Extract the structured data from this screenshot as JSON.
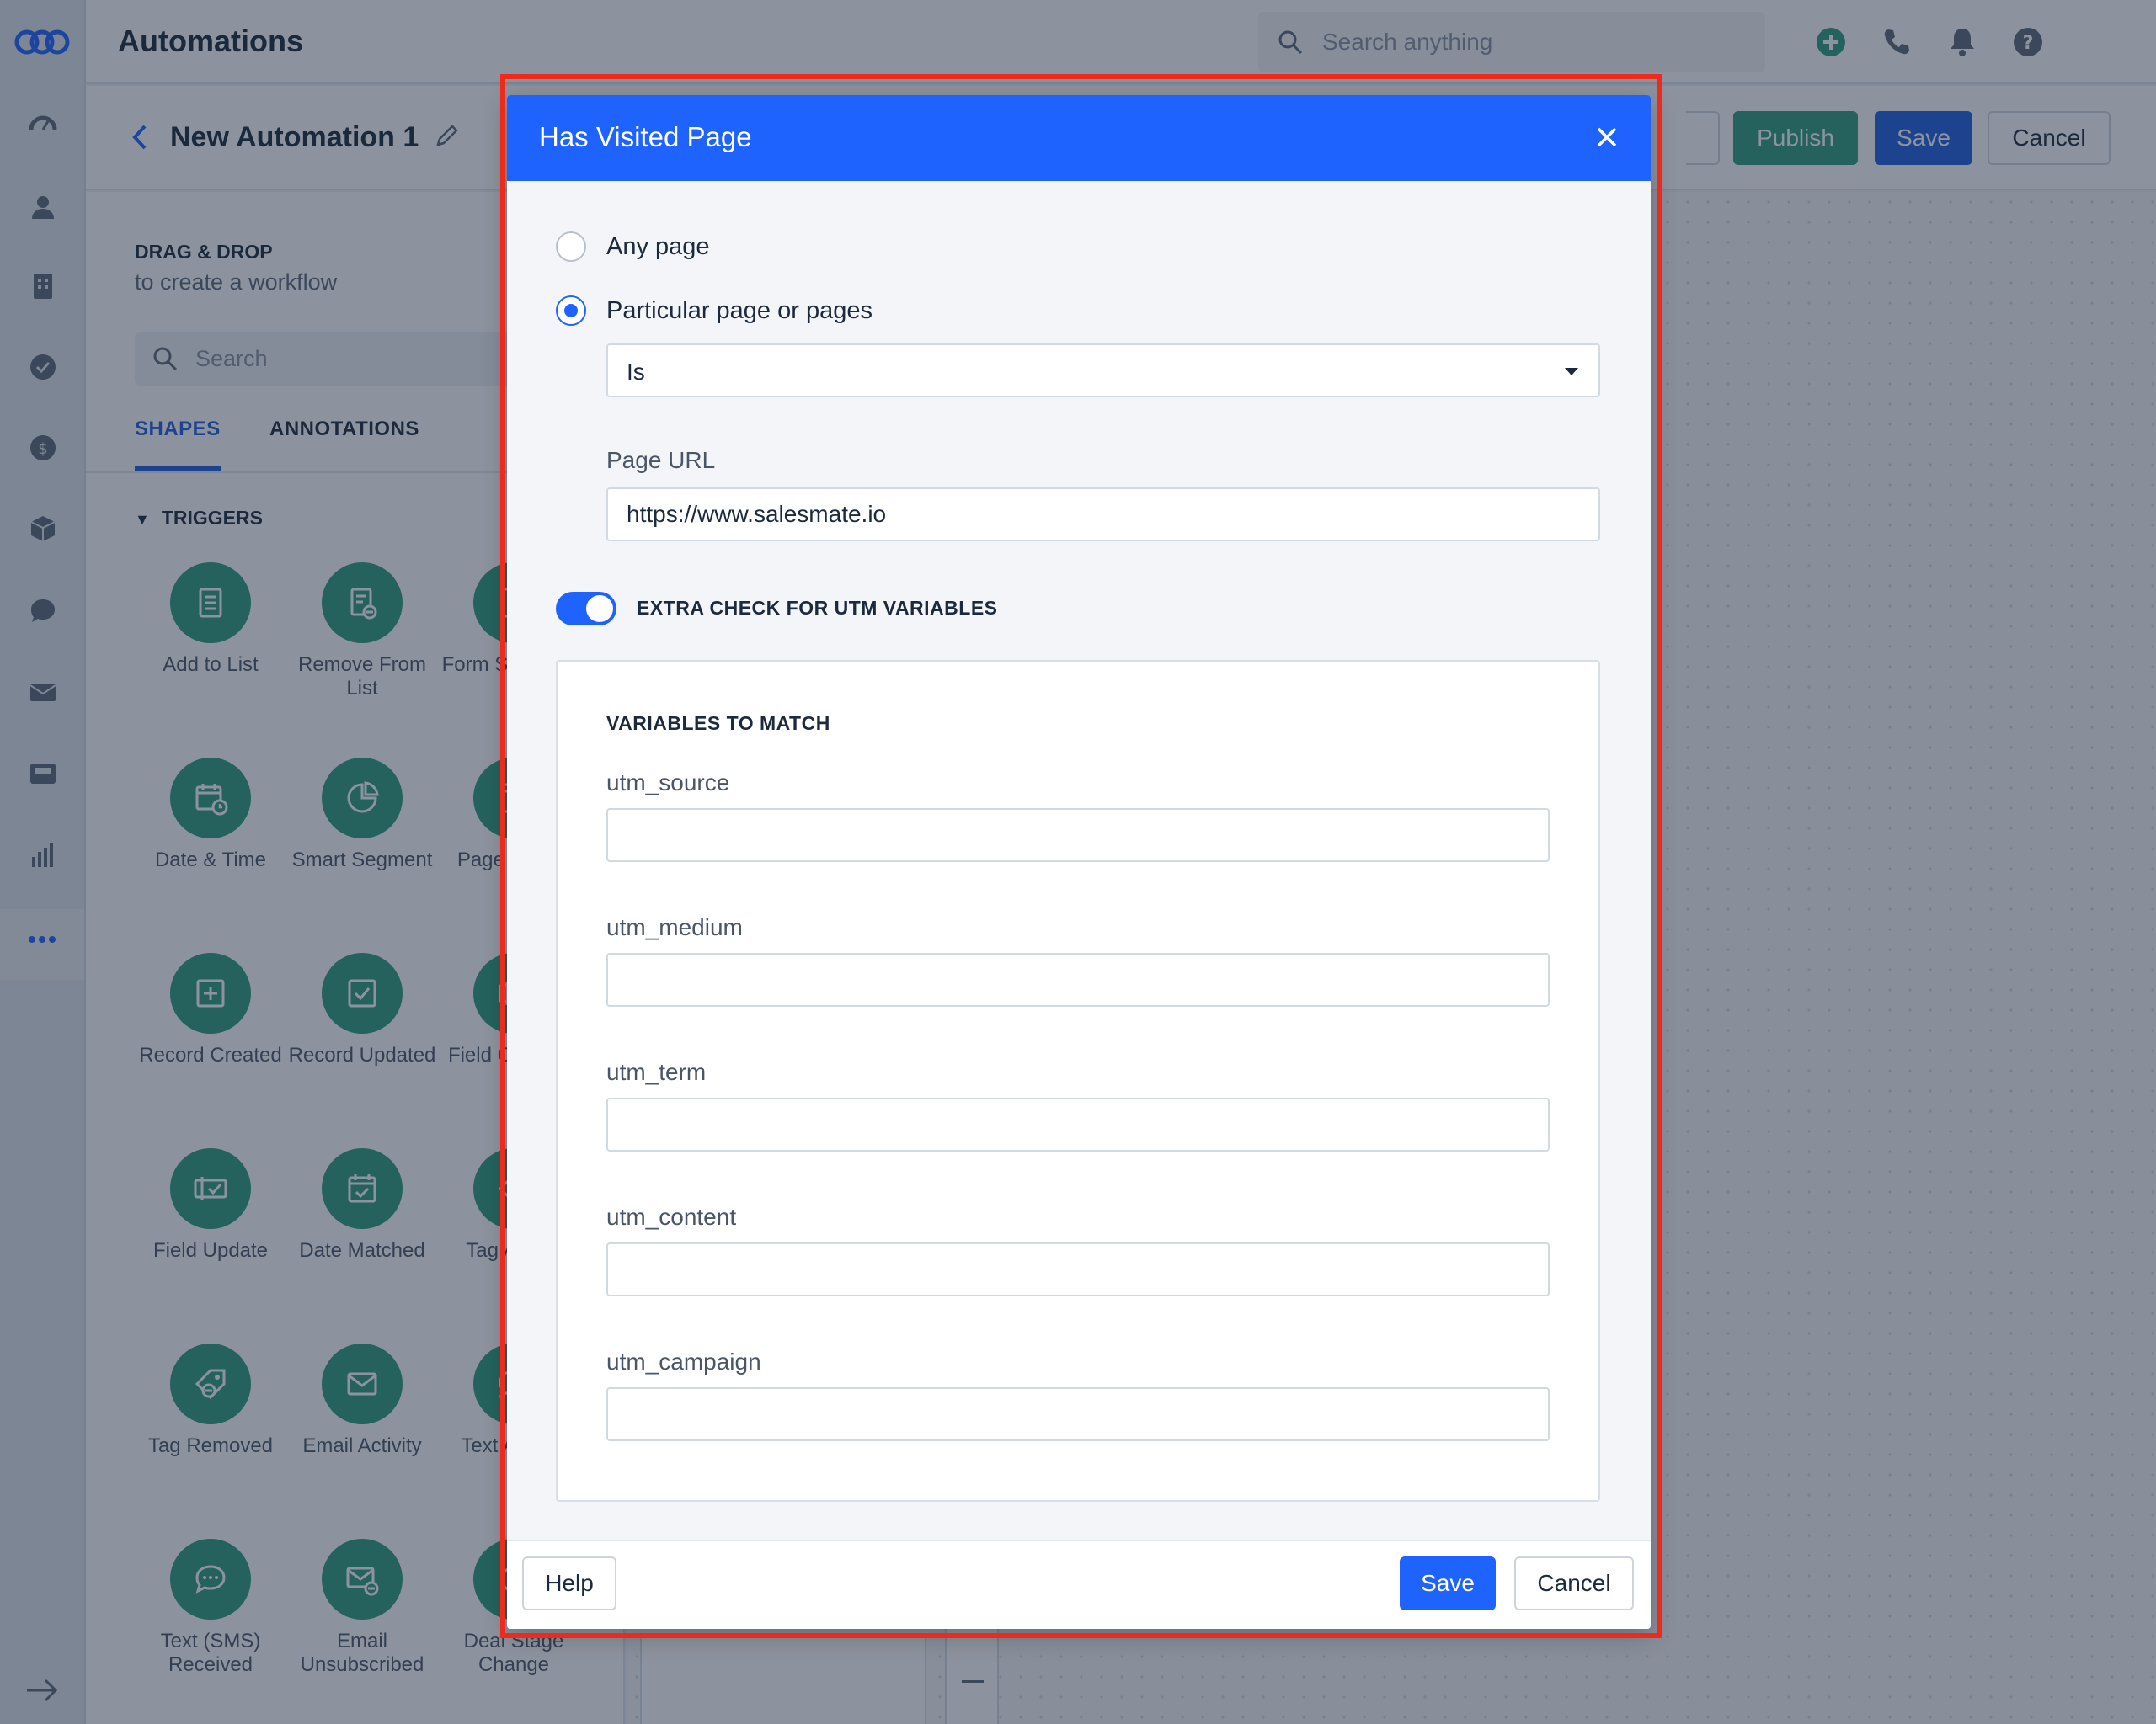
{
  "app": {
    "title": "Automations"
  },
  "header": {
    "search_placeholder": "Search anything"
  },
  "subheader": {
    "automation_name": "New Automation 1",
    "publish_label": "Publish",
    "save_label": "Save",
    "cancel_label": "Cancel"
  },
  "panel": {
    "title": "DRAG & DROP",
    "subtitle": "to create a workflow",
    "search_placeholder": "Search",
    "tabs": [
      "SHAPES",
      "ANNOTATIONS"
    ],
    "section": "TRIGGERS",
    "shapes": [
      {
        "label": "Add to List",
        "icon": "list-icon"
      },
      {
        "label": "Remove From List",
        "icon": "list-remove-icon"
      },
      {
        "label": "Form Submitted",
        "icon": "form-icon"
      },
      {
        "label": "Date & Time",
        "icon": "calendar-clock-icon"
      },
      {
        "label": "Smart Segment",
        "icon": "segment-icon"
      },
      {
        "label": "Page Visited",
        "icon": "page-icon"
      },
      {
        "label": "Record Created",
        "icon": "plus-square-icon"
      },
      {
        "label": "Record Updated",
        "icon": "check-square-icon"
      },
      {
        "label": "Field Changed",
        "icon": "field-icon"
      },
      {
        "label": "Field Update",
        "icon": "field-update-icon"
      },
      {
        "label": "Date Matched",
        "icon": "calendar-check-icon"
      },
      {
        "label": "Tag Added",
        "icon": "tag-icon"
      },
      {
        "label": "Tag Removed",
        "icon": "tag-remove-icon"
      },
      {
        "label": "Email Activity",
        "icon": "envelope-icon"
      },
      {
        "label": "Text Activity",
        "icon": "chat-icon"
      },
      {
        "label": "Text (SMS) Received",
        "icon": "sms-icon"
      },
      {
        "label": "Email Unsubscribed",
        "icon": "envelope-remove-icon"
      },
      {
        "label": "Deal Stage Change",
        "icon": "stage-icon"
      }
    ]
  },
  "modal": {
    "title": "Has Visited Page",
    "option_any": "Any page",
    "option_particular": "Particular page or pages",
    "condition": "Is",
    "page_url_label": "Page URL",
    "page_url_value": "https://www.salesmate.io",
    "utm_toggle_label": "EXTRA CHECK FOR UTM VARIABLES",
    "utm_toggle_on": true,
    "vars_title": "VARIABLES TO MATCH",
    "vars": [
      {
        "label": "utm_source",
        "value": ""
      },
      {
        "label": "utm_medium",
        "value": ""
      },
      {
        "label": "utm_term",
        "value": ""
      },
      {
        "label": "utm_content",
        "value": ""
      },
      {
        "label": "utm_campaign",
        "value": ""
      }
    ],
    "help_label": "Help",
    "save_label": "Save",
    "cancel_label": "Cancel"
  },
  "colors": {
    "primary": "#1f63ff",
    "accent_green": "#2e9c7c",
    "highlight": "#ee2a1c"
  }
}
